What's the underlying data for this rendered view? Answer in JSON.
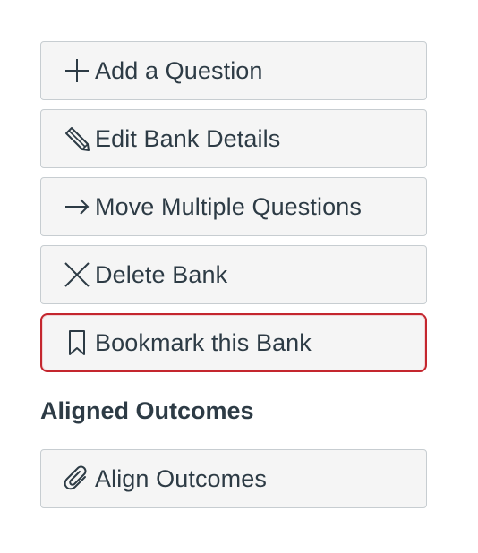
{
  "actions": {
    "add_question": "Add a Question",
    "edit_bank_details": "Edit Bank Details",
    "move_multiple_questions": "Move Multiple Questions",
    "delete_bank": "Delete Bank",
    "bookmark_bank": "Bookmark this Bank"
  },
  "outcomes": {
    "heading": "Aligned Outcomes",
    "align_button": "Align Outcomes"
  },
  "colors": {
    "button_bg": "#f5f5f5",
    "button_border": "#c7cdd1",
    "focus_ring": "#c4262e",
    "text": "#2d3b45"
  }
}
